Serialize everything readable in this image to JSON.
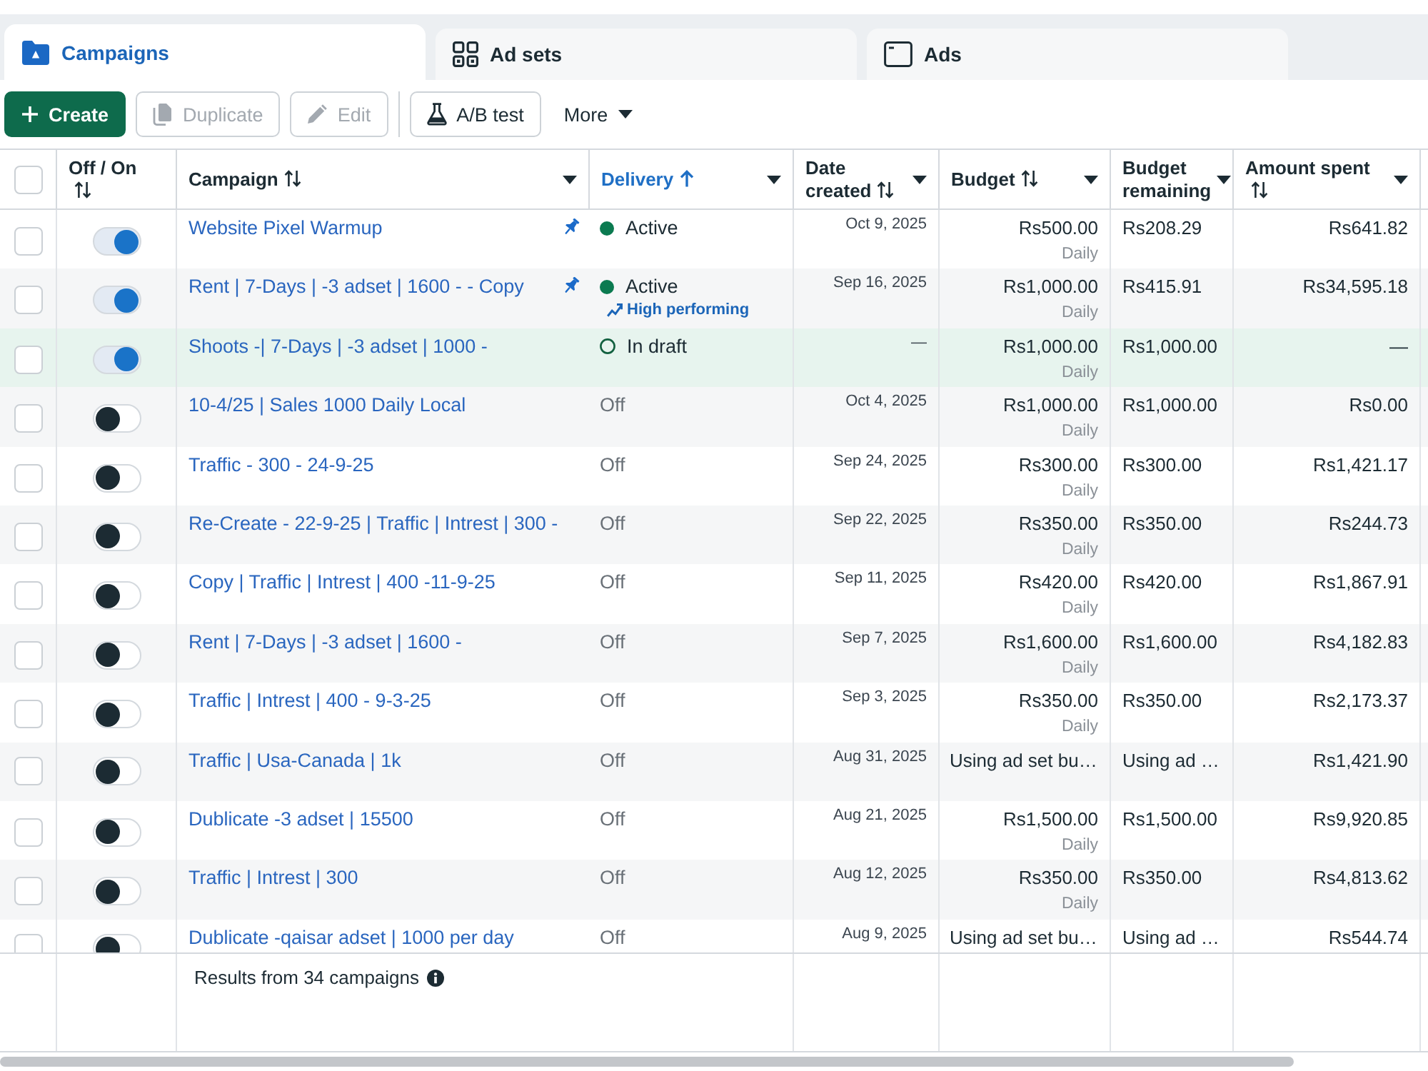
{
  "tabs": [
    {
      "label": "Campaigns",
      "kind": "campaign",
      "selected": true
    },
    {
      "label": "Ad sets",
      "kind": "adset",
      "selected": false
    },
    {
      "label": "Ads",
      "kind": "ad",
      "selected": false
    }
  ],
  "toolbar": [
    {
      "label": "Create",
      "kind": "create",
      "disabled": false
    },
    {
      "label": "Duplicate",
      "kind": "duplicate",
      "disabled": true
    },
    {
      "label": "Edit",
      "kind": "edit",
      "disabled": true
    },
    {
      "label": "A/B test",
      "kind": "abtest",
      "disabled": false
    },
    {
      "label": "More",
      "kind": "more",
      "disabled": false
    }
  ],
  "table": {
    "select_all": {
      "checked": false
    },
    "columns": [
      {
        "label": "Off / On",
        "kind": "sortable",
        "sorted": false,
        "menu": false
      },
      {
        "label": "Campaign",
        "kind": "sortable",
        "sorted": false,
        "menu": true
      },
      {
        "label": "Delivery",
        "kind": "sortable",
        "sorted": true,
        "menu": true
      },
      {
        "label": "Date created",
        "kind": "sortable",
        "sorted": false,
        "menu": true
      },
      {
        "label": "Budget",
        "kind": "sortable",
        "sorted": false,
        "menu": true
      },
      {
        "label": "Budget remaining",
        "kind": "plain",
        "sorted": false,
        "menu": true
      },
      {
        "label": "Amount spent",
        "kind": "sortable",
        "sorted": false,
        "menu": true
      }
    ],
    "rows": [
      {
        "checked": false,
        "on": true,
        "highlighted": false,
        "name": "Website Pixel Warmup",
        "pinned": true,
        "delivery": {
          "kind": "active",
          "label": "Active"
        },
        "date_created": "Oct 9, 2025",
        "budget": {
          "kind": "fixed",
          "amount": "Rs500.00",
          "period": "Daily"
        },
        "budget_remaining": "Rs208.29",
        "amount_spent": "Rs641.82"
      },
      {
        "checked": false,
        "on": true,
        "highlighted": false,
        "name": "Rent | 7-Days | -3 adset | 1600 - - Copy",
        "pinned": true,
        "delivery": {
          "kind": "active",
          "label": "Active",
          "badge": "High performing"
        },
        "date_created": "Sep 16, 2025",
        "budget": {
          "kind": "fixed",
          "amount": "Rs1,000.00",
          "period": "Daily"
        },
        "budget_remaining": "Rs415.91",
        "amount_spent": "Rs34,595.18"
      },
      {
        "checked": false,
        "on": true,
        "highlighted": true,
        "name": "Shoots -| 7-Days | -3 adset | 1000 -",
        "pinned": false,
        "delivery": {
          "kind": "draft",
          "label": "In draft"
        },
        "date_created": "—",
        "budget": {
          "kind": "fixed",
          "amount": "Rs1,000.00",
          "period": "Daily"
        },
        "budget_remaining": "Rs1,000.00",
        "amount_spent": "—"
      },
      {
        "checked": false,
        "on": false,
        "highlighted": false,
        "name": "10-4/25 | Sales 1000 Daily Local",
        "pinned": false,
        "delivery": {
          "kind": "off",
          "label": "Off"
        },
        "date_created": "Oct 4, 2025",
        "budget": {
          "kind": "fixed",
          "amount": "Rs1,000.00",
          "period": "Daily"
        },
        "budget_remaining": "Rs1,000.00",
        "amount_spent": "Rs0.00"
      },
      {
        "checked": false,
        "on": false,
        "highlighted": false,
        "name": "Traffic - 300 - 24-9-25",
        "pinned": false,
        "delivery": {
          "kind": "off",
          "label": "Off"
        },
        "date_created": "Sep 24, 2025",
        "budget": {
          "kind": "fixed",
          "amount": "Rs300.00",
          "period": "Daily"
        },
        "budget_remaining": "Rs300.00",
        "amount_spent": "Rs1,421.17"
      },
      {
        "checked": false,
        "on": false,
        "highlighted": false,
        "name": "Re-Create - 22-9-25 | Traffic | Intrest | 300 -",
        "pinned": false,
        "delivery": {
          "kind": "off",
          "label": "Off"
        },
        "date_created": "Sep 22, 2025",
        "budget": {
          "kind": "fixed",
          "amount": "Rs350.00",
          "period": "Daily"
        },
        "budget_remaining": "Rs350.00",
        "amount_spent": "Rs244.73"
      },
      {
        "checked": false,
        "on": false,
        "highlighted": false,
        "name": "Copy | Traffic | Intrest | 400 -11-9-25",
        "pinned": false,
        "delivery": {
          "kind": "off",
          "label": "Off"
        },
        "date_created": "Sep 11, 2025",
        "budget": {
          "kind": "fixed",
          "amount": "Rs420.00",
          "period": "Daily"
        },
        "budget_remaining": "Rs420.00",
        "amount_spent": "Rs1,867.91"
      },
      {
        "checked": false,
        "on": false,
        "highlighted": false,
        "name": "Rent | 7-Days | -3 adset | 1600 -",
        "pinned": false,
        "delivery": {
          "kind": "off",
          "label": "Off"
        },
        "date_created": "Sep 7, 2025",
        "budget": {
          "kind": "fixed",
          "amount": "Rs1,600.00",
          "period": "Daily"
        },
        "budget_remaining": "Rs1,600.00",
        "amount_spent": "Rs4,182.83"
      },
      {
        "checked": false,
        "on": false,
        "highlighted": false,
        "name": "Traffic | Intrest | 400 - 9-3-25",
        "pinned": false,
        "delivery": {
          "kind": "off",
          "label": "Off"
        },
        "date_created": "Sep 3, 2025",
        "budget": {
          "kind": "fixed",
          "amount": "Rs350.00",
          "period": "Daily"
        },
        "budget_remaining": "Rs350.00",
        "amount_spent": "Rs2,173.37"
      },
      {
        "checked": false,
        "on": false,
        "highlighted": false,
        "name": "Traffic | Usa-Canada | 1k",
        "pinned": false,
        "delivery": {
          "kind": "off",
          "label": "Off"
        },
        "date_created": "Aug 31, 2025",
        "budget": {
          "kind": "adset",
          "text": "Using ad set bu…"
        },
        "budget_remaining": "Using ad …",
        "amount_spent": "Rs1,421.90"
      },
      {
        "checked": false,
        "on": false,
        "highlighted": false,
        "name": "Dublicate -3 adset | 15500",
        "pinned": false,
        "delivery": {
          "kind": "off",
          "label": "Off"
        },
        "date_created": "Aug 21, 2025",
        "budget": {
          "kind": "fixed",
          "amount": "Rs1,500.00",
          "period": "Daily"
        },
        "budget_remaining": "Rs1,500.00",
        "amount_spent": "Rs9,920.85"
      },
      {
        "checked": false,
        "on": false,
        "highlighted": false,
        "name": "Traffic | Intrest | 300",
        "pinned": false,
        "delivery": {
          "kind": "off",
          "label": "Off"
        },
        "date_created": "Aug 12, 2025",
        "budget": {
          "kind": "fixed",
          "amount": "Rs350.00",
          "period": "Daily"
        },
        "budget_remaining": "Rs350.00",
        "amount_spent": "Rs4,813.62"
      },
      {
        "checked": false,
        "on": false,
        "highlighted": false,
        "name": "Dublicate -qaisar adset | 1000 per day",
        "pinned": false,
        "delivery": {
          "kind": "off",
          "label": "Off"
        },
        "date_created": "Aug 9, 2025",
        "budget": {
          "kind": "adset",
          "text": "Using ad set bu…"
        },
        "budget_remaining": "Using ad …",
        "amount_spent": "Rs544.74"
      }
    ],
    "footer": {
      "text": "Results from 34 campaigns"
    }
  }
}
